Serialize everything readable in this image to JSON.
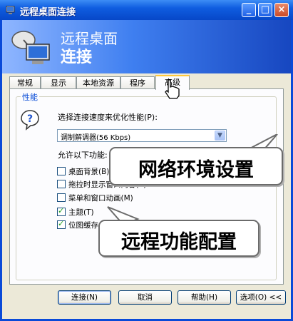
{
  "window": {
    "title": "远程桌面连接",
    "buttons": {
      "minimize": "_",
      "maximize": "□",
      "close": "×"
    }
  },
  "banner": {
    "line1": "远程桌面",
    "line2": "连接"
  },
  "tabs": [
    {
      "label": "常规"
    },
    {
      "label": "显示"
    },
    {
      "label": "本地资源"
    },
    {
      "label": "程序"
    },
    {
      "label": "高级"
    }
  ],
  "performance": {
    "group_label": "性能",
    "description": "选择连接速度来优化性能(P):",
    "speed_select_value": "调制解调器(56 Kbps)",
    "allow_label": "允许以下功能:",
    "options": [
      {
        "label": "桌面背景(B)",
        "checked": false
      },
      {
        "label": "拖拉时显示窗口内容(S)",
        "checked": false
      },
      {
        "label": "菜单和窗口动画(M)",
        "checked": false
      },
      {
        "label": "主题(T)",
        "checked": true
      },
      {
        "label": "位图缓存",
        "checked": true
      }
    ]
  },
  "callouts": {
    "network": "网络环境设置",
    "remote": "远程功能配置"
  },
  "footer": {
    "connect": "连接(N)",
    "cancel": "取消",
    "help": "帮助(H)",
    "options": "选项(O) <<"
  }
}
